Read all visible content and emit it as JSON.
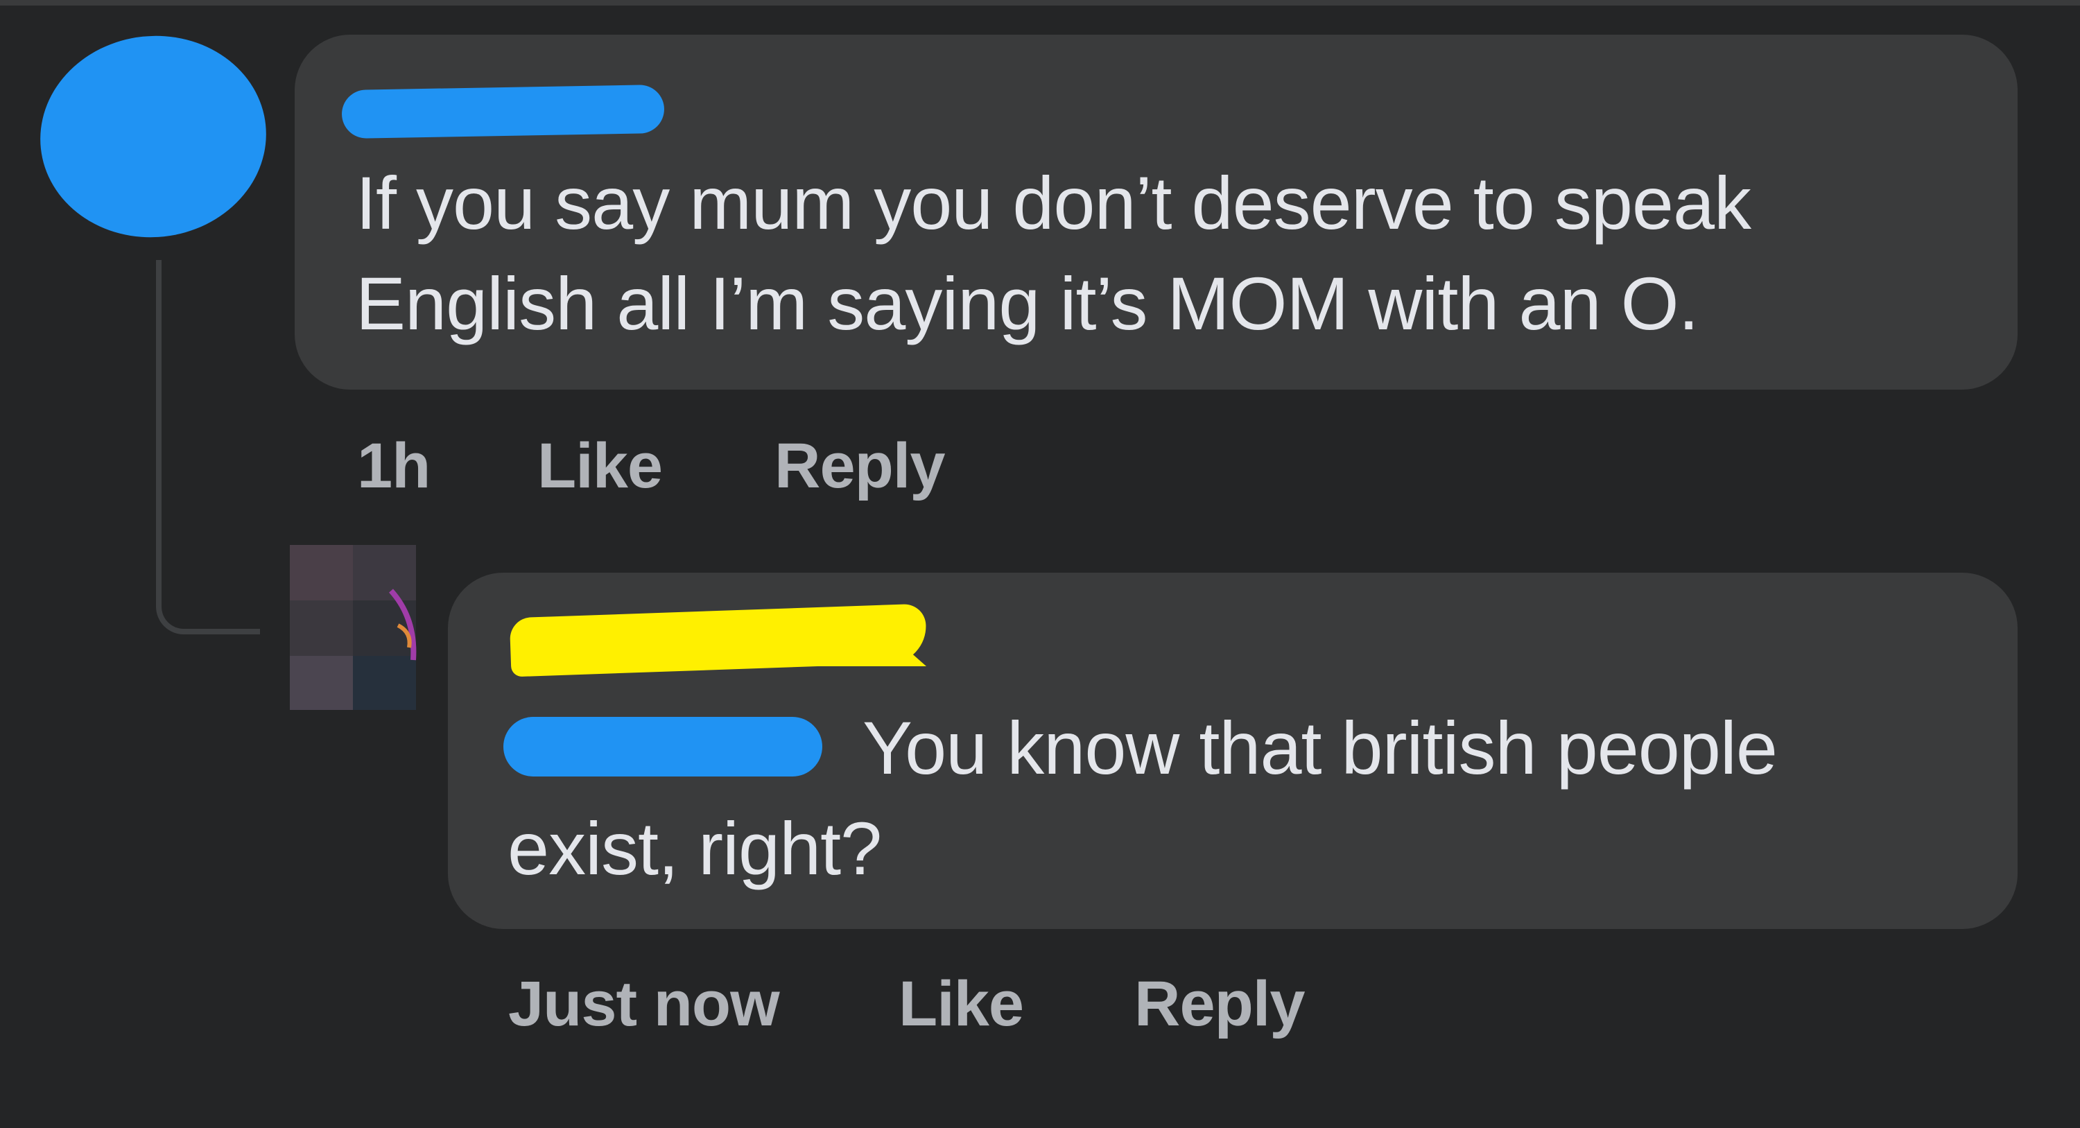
{
  "comments": [
    {
      "text_lines": [
        "If you say mum you don’t deserve to speak",
        "English all I’m saying it’s MOM with an O."
      ],
      "actions": {
        "time": "1h",
        "like": "Like",
        "reply": "Reply"
      }
    }
  ],
  "replies": [
    {
      "text_line_1": "You know that british people",
      "text_line_2": "exist, right?",
      "actions": {
        "time": "Just now",
        "like": "Like",
        "reply": "Reply"
      }
    }
  ],
  "colors": {
    "background": "#242526",
    "bubble": "#3a3b3c",
    "text": "#e4e6eb",
    "meta_text": "#b0b3b8",
    "redaction_blue": "#2093f3",
    "redaction_yellow": "#fff000"
  }
}
